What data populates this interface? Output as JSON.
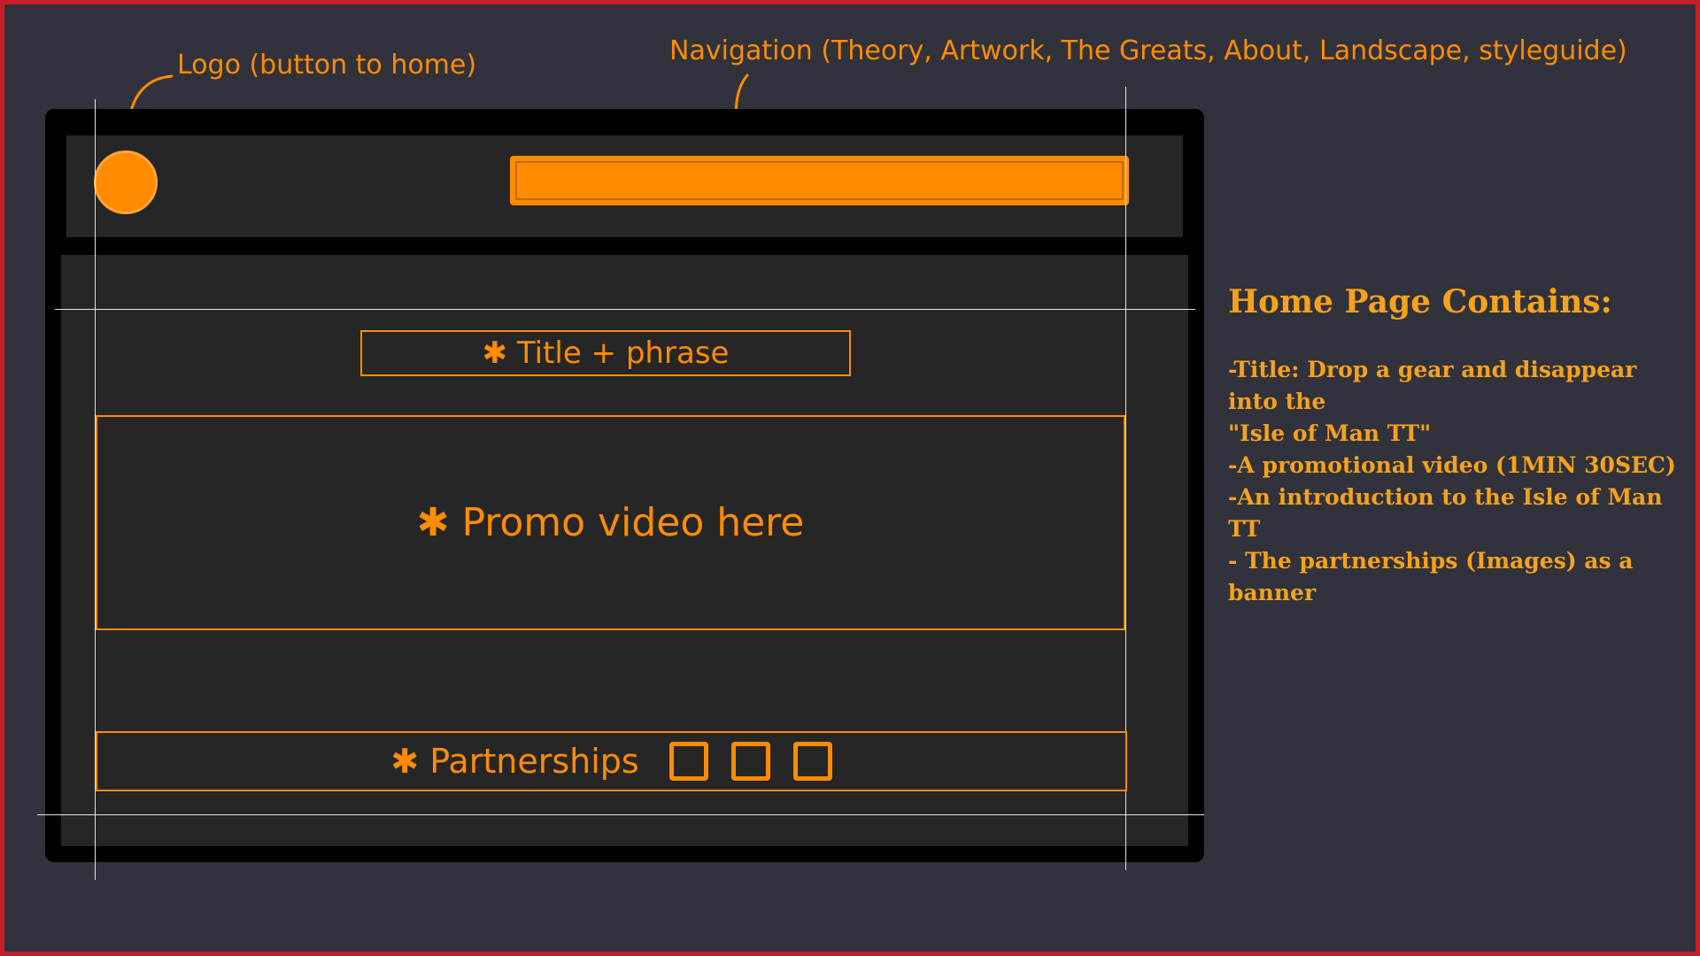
{
  "annotations": {
    "logo": "Logo (button to home)",
    "navigation": "Navigation (Theory, Artwork, The Greats, About, Landscape, styleguide)"
  },
  "wireframe": {
    "title_box": "✱ Title + phrase",
    "video_box": "✱ Promo video here",
    "partnerships_box": "✱ Partnerships",
    "partner_placeholder_count": 3
  },
  "notes": {
    "heading": "Home Page Contains:",
    "lines": [
      "-Title: Drop a gear and disappear into the",
      "\"Isle of Man TT\"",
      "-A promotional video (1MIN 30SEC)",
      "-An introduction to the Isle of Man TT",
      "- The partnerships (Images) as a banner"
    ]
  },
  "colors": {
    "accent": "#ff8c00",
    "background": "#31323b",
    "panel": "#262626",
    "frame": "#000000",
    "border": "#c5202a"
  }
}
